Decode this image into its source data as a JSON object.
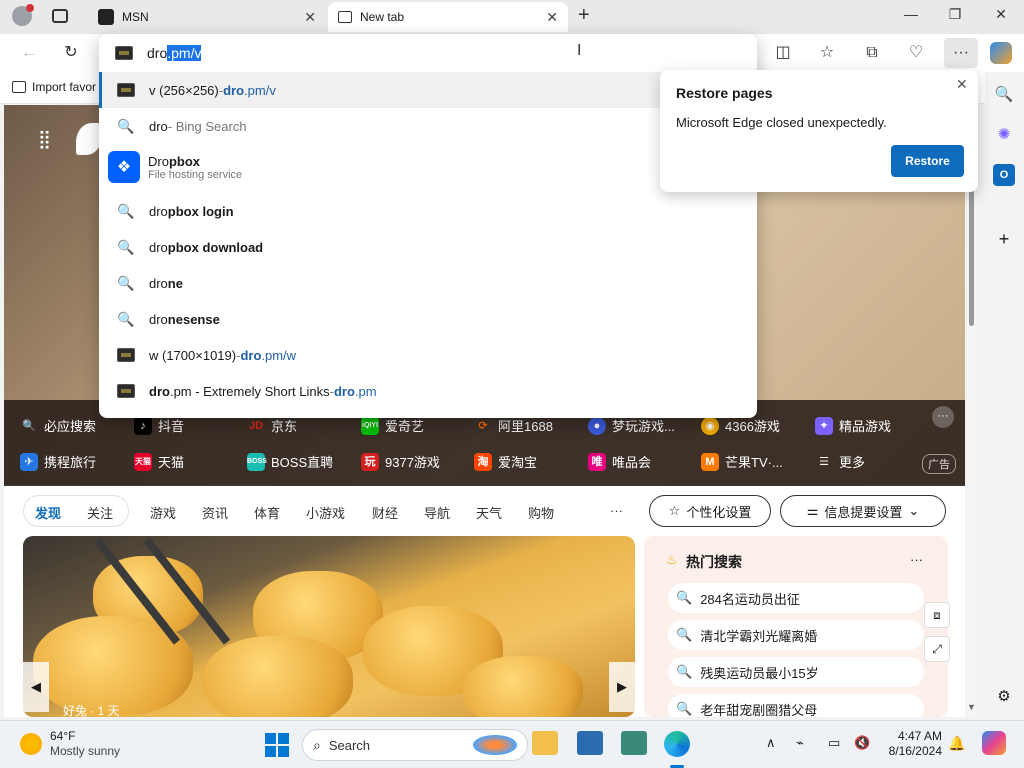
{
  "titlebar": {
    "tabs": [
      {
        "label": "MSN",
        "close": "✕"
      },
      {
        "label": "New tab",
        "close": "✕"
      }
    ],
    "new_tab": "+",
    "minimize": "—",
    "restore": "❐",
    "close": "✕"
  },
  "omnibox": {
    "typed": "dro",
    "autocomplete": ".pm/v",
    "suggestions": [
      {
        "main": "v (256×256)",
        "sep": " - ",
        "url_bold": "dro",
        "url_rest": ".pm/v"
      },
      {
        "main": "dro",
        "sub": " - Bing Search"
      },
      {
        "title_plain": "Dro",
        "title_bold": "pbox",
        "desc": "File hosting service"
      },
      {
        "plain": "dro",
        "bold": "pbox login"
      },
      {
        "plain": "dro",
        "bold": "pbox download"
      },
      {
        "plain": "dro",
        "bold": "ne"
      },
      {
        "plain": "dro",
        "bold": "nesense"
      },
      {
        "main": "w (1700×1019)",
        "sep": " - ",
        "url_bold": "dro",
        "url_rest": ".pm/w"
      },
      {
        "main_bold": "dro",
        "main_rest": ".pm - Extremely Short Links",
        "sep": " - ",
        "url_bold": "dro",
        "url_rest": ".pm"
      }
    ]
  },
  "favbar": {
    "import": "Import favor"
  },
  "restore_popup": {
    "title": "Restore pages",
    "message": "Microsoft Edge closed unexpectedly.",
    "button": "Restore",
    "close": "✕"
  },
  "quicklinks": {
    "row1": [
      "必应搜索",
      "抖音",
      "京东",
      "爱奇艺",
      "阿里1688",
      "梦玩游戏...",
      "4366游戏",
      "精品游戏"
    ],
    "row2": [
      "携程旅行",
      "天猫",
      "BOSS直聘",
      "9377游戏",
      "爱淘宝",
      "唯品会",
      "芒果TV·...",
      "更多"
    ],
    "ad": "广告",
    "more": "···"
  },
  "nav": {
    "tabs": [
      "发现",
      "关注",
      "游戏",
      "资讯",
      "体育",
      "小游戏",
      "财经",
      "导航",
      "天气",
      "购物",
      "···"
    ],
    "personalize": "个性化设置",
    "info_settings": "信息提要设置"
  },
  "feed": {
    "caption": "好兔 · 1 天"
  },
  "hot_search": {
    "title": "热门搜索",
    "more": "···",
    "items": [
      "284名运动员出征",
      "清北学霸刘光耀离婚",
      "残奥运动员最小15岁",
      "老年甜宠剧圈猎父母"
    ]
  },
  "taskbar": {
    "temp": "64°F",
    "weather": "Mostly sunny",
    "search": "Search",
    "time": "4:47 AM",
    "date": "8/16/2024"
  },
  "colors": {
    "accent": "#0f6cbd",
    "selection": "#1a73e8"
  }
}
